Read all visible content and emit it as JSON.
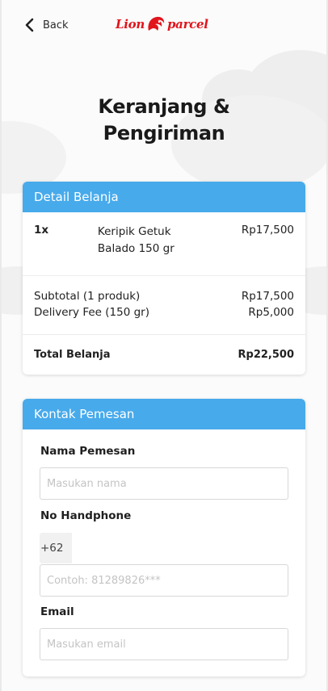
{
  "header": {
    "back_label": "Back",
    "logo_left": "Lion",
    "logo_right": "parcel",
    "brand_color": "#e1141c"
  },
  "page_title_line1": "Keranjang &",
  "page_title_line2": "Pengiriman",
  "detail": {
    "title": "Detail Belanja",
    "item": {
      "qty": "1x",
      "name": "Keripik Getuk Balado 150 gr",
      "price": "Rp17,500"
    },
    "subtotal_label": "Subtotal (1 produk)",
    "subtotal_value": "Rp17,500",
    "delivery_label": "Delivery Fee (150 gr)",
    "delivery_value": "Rp5,000",
    "total_label": "Total Belanja",
    "total_value": "Rp22,500"
  },
  "contact": {
    "title": "Kontak Pemesan",
    "name_label": "Nama Pemesan",
    "name_placeholder": "Masukan nama",
    "phone_label": "No Handphone",
    "phone_prefix": "+62",
    "phone_placeholder": "Contoh: 81289826***",
    "email_label": "Email",
    "email_placeholder": "Masukan email"
  },
  "colors": {
    "accent": "#47aaeb",
    "background": "#fbfbfb"
  }
}
